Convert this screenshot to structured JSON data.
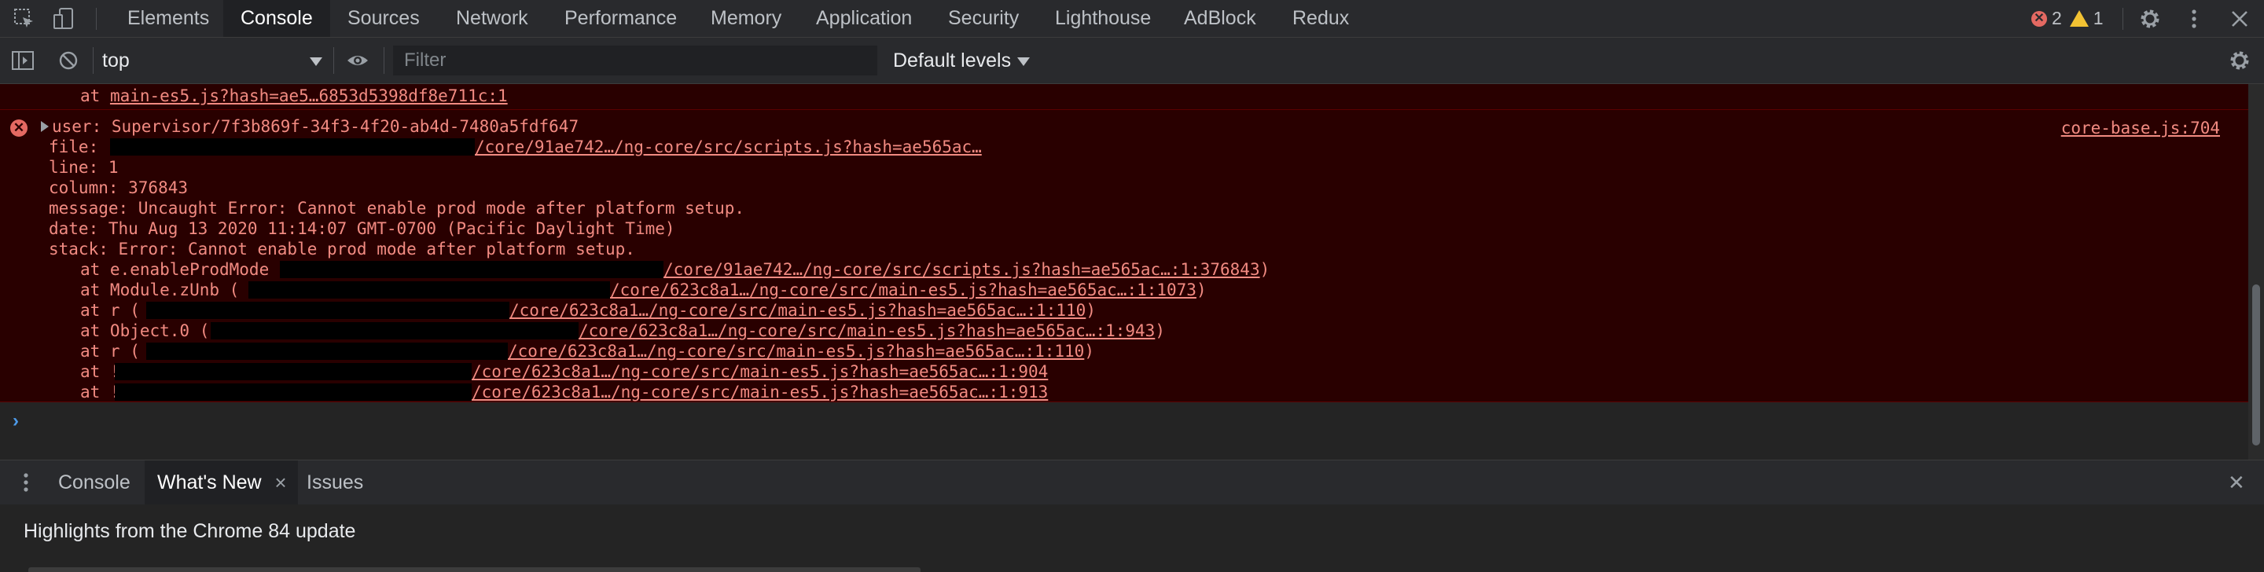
{
  "toolbar": {
    "tabs": [
      "Elements",
      "Console",
      "Sources",
      "Network",
      "Performance",
      "Memory",
      "Application",
      "Security",
      "Lighthouse",
      "AdBlock",
      "Redux"
    ],
    "active_tab": "Console",
    "error_count": "2",
    "warning_count": "1"
  },
  "console_toolbar": {
    "context": "top",
    "filter_placeholder": "Filter",
    "levels_label": "Default levels"
  },
  "console": {
    "prev_line": {
      "prefix": "at ",
      "link": "main-es5.js?hash=ae5…6853d5398df8e711c:1"
    },
    "error": {
      "header": "user: Supervisor/7f3b869f-34f3-4f20-ab4d-7480a5fdf647",
      "source_link": "core-base.js:704",
      "file_label": "file:",
      "file_link": "/core/91ae742…/ng-core/src/scripts.js?hash=ae565ac…",
      "line_text": "line: 1",
      "column_text": "column: 376843",
      "message_text": "message: Uncaught Error: Cannot enable prod mode after platform setup.",
      "date_text": "date: Thu Aug 13 2020 11:14:07 GMT-0700 (Pacific Daylight Time)",
      "stack_text": "stack: Error: Cannot enable prod mode after platform setup.",
      "frames": [
        {
          "prefix": "at e.enableProdMode",
          "link": "/core/91ae742…/ng-core/src/scripts.js?hash=ae565ac…:1:376843",
          "suffix": ")"
        },
        {
          "prefix": "at Module.zUnb (",
          "link": "/core/623c8a1…/ng-core/src/main-es5.js?hash=ae565ac…:1:1073",
          "suffix": ")"
        },
        {
          "prefix": "at r (",
          "link": "/core/623c8a1…/ng-core/src/main-es5.js?hash=ae565ac…:1:110",
          "suffix": ")"
        },
        {
          "prefix": "at Object.0 (",
          "link": "/core/623c8a1…/ng-core/src/main-es5.js?hash=ae565ac…:1:943",
          "suffix": ")"
        },
        {
          "prefix": "at r (",
          "link": "/core/623c8a1…/ng-core/src/main-es5.js?hash=ae565ac…:1:110",
          "suffix": ")"
        },
        {
          "prefix": "at !",
          "link": "/core/623c8a1…/ng-core/src/main-es5.js?hash=ae565ac…:1:904",
          "suffix": ""
        },
        {
          "prefix": "at !",
          "link": "/core/623c8a1…/ng-core/src/main-es5.js?hash=ae565ac…:1:913",
          "suffix": ""
        }
      ]
    },
    "prompt": "›"
  },
  "drawer": {
    "tabs": [
      "Console",
      "What's New",
      "Issues"
    ],
    "active_tab": "What's New",
    "close_tab_glyph": "×",
    "close_glyph": "✕",
    "body_text": "Highlights from the Chrome 84 update"
  },
  "colors": {
    "error_bg": "#290000",
    "error_text": "#f28b82",
    "panel_bg": "#242424",
    "toolbar_bg": "#292a2d"
  }
}
